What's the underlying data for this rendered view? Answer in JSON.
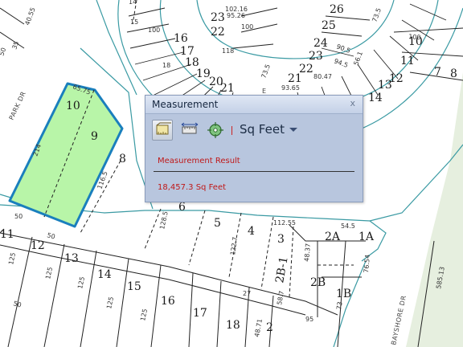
{
  "map": {
    "road_labels": [
      "PARK DR",
      "BAYSHORE DR",
      "E"
    ],
    "lot_labels": [
      "10",
      "9",
      "8",
      "6",
      "5",
      "4",
      "3",
      "2A",
      "1A",
      "11",
      "12",
      "13",
      "14",
      "15",
      "16",
      "17",
      "18",
      "2",
      "2B-1",
      "2B",
      "1B",
      "23",
      "22",
      "16",
      "17",
      "18",
      "19",
      "20",
      "21",
      "26",
      "25",
      "24",
      "23",
      "22",
      "21",
      "10",
      "11",
      "12",
      "13",
      "14",
      "8",
      "7"
    ],
    "dimension_labels": [
      "65.75",
      "214",
      "116.5",
      "128.5",
      "122.7",
      "112.55",
      "54.5",
      "48.37",
      "76.54",
      "50",
      "50",
      "50",
      "125",
      "125",
      "125",
      "125",
      "125",
      "27",
      "58.7",
      "95",
      "73",
      "585.13",
      "50",
      "35",
      "40.55",
      "102.16",
      "95.26",
      "100",
      "100",
      "118",
      "93.65",
      "80.47",
      "94.5",
      "90.5",
      "56.1",
      "15",
      "14",
      "18",
      "73.5",
      "73.5",
      "48.71",
      "100"
    ],
    "selection_color": "#b8f5a8",
    "selection_border": "#1a7fbd",
    "park_color": "#e6f0df"
  },
  "panel": {
    "title": "Measurement",
    "close": "x",
    "tools": [
      "area-tool-icon",
      "distance-tool-icon",
      "location-tool-icon"
    ],
    "unit": "Sq Feet",
    "result_label": "Measurement Result",
    "result_value": "18,457.3 Sq Feet"
  }
}
